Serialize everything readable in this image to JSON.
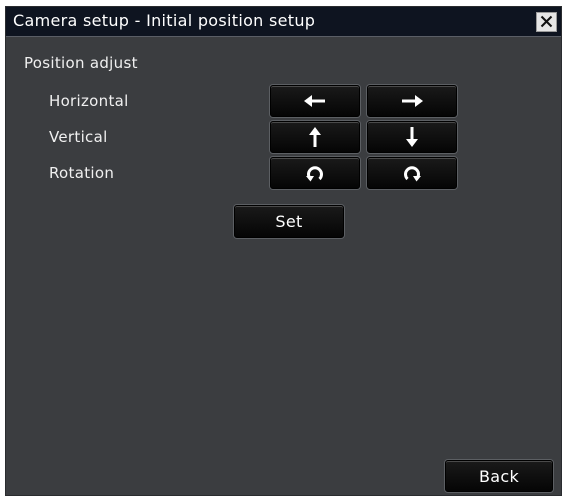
{
  "window": {
    "title": "Camera setup - Initial position setup"
  },
  "position_adjust": {
    "section_label": "Position adjust",
    "horizontal_label": "Horizontal",
    "vertical_label": "Vertical",
    "rotation_label": "Rotation",
    "buttons": {
      "left_icon": "arrow-left-icon",
      "right_icon": "arrow-right-icon",
      "up_icon": "arrow-up-icon",
      "down_icon": "arrow-down-icon",
      "rotate_ccw_icon": "rotate-counterclockwise-icon",
      "rotate_cw_icon": "rotate-clockwise-icon"
    }
  },
  "actions": {
    "set_label": "Set",
    "back_label": "Back"
  },
  "colors": {
    "panel_background": "#3b3d40",
    "title_bar": "#0e1420",
    "button_background": "#0a0a0a",
    "text": "#ffffff"
  }
}
